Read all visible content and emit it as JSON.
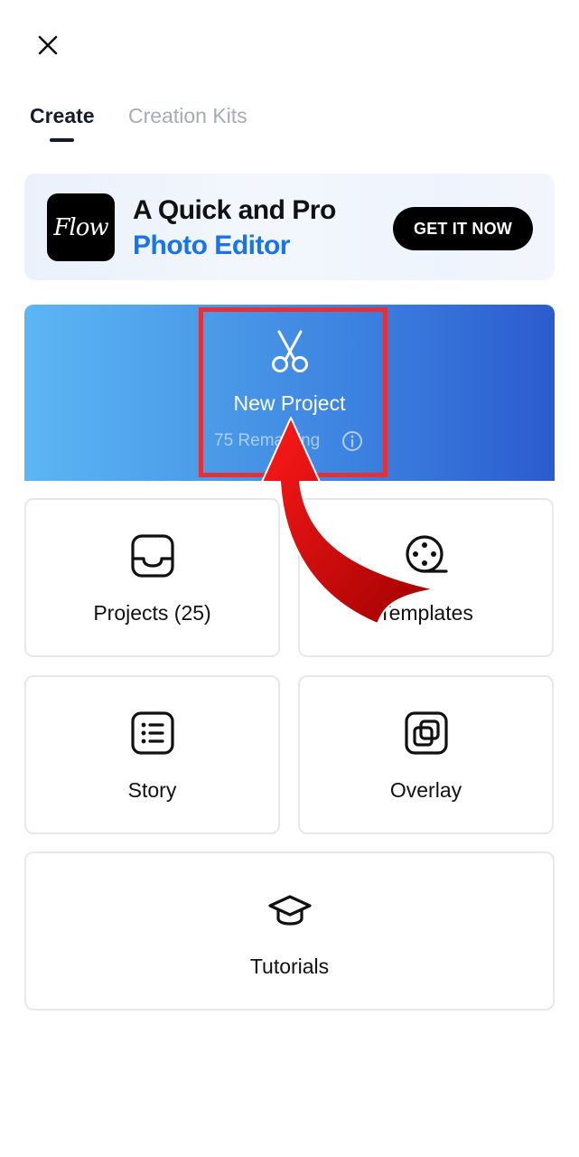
{
  "header": {
    "close_icon": "close-icon"
  },
  "tabs": [
    {
      "label": "Create",
      "active": true
    },
    {
      "label": "Creation Kits",
      "active": false
    }
  ],
  "banner": {
    "logo_text": "Flow",
    "title_line1": "A Quick and Pro",
    "title_line2": "Photo Editor",
    "cta": "GET IT NOW",
    "accent_color": "#1a73e8"
  },
  "new_project": {
    "label": "New Project",
    "remaining": "75 Remaining",
    "icon": "scissors-icon",
    "info_icon": "info-icon"
  },
  "grid": [
    {
      "label": "Projects (25)",
      "icon": "inbox-tray-icon"
    },
    {
      "label": "Templates",
      "icon": "film-reel-icon"
    },
    {
      "label": "Story",
      "icon": "list-icon"
    },
    {
      "label": "Overlay",
      "icon": "layers-icon"
    },
    {
      "label": "Tutorials",
      "icon": "graduation-cap-icon"
    }
  ],
  "annotation": {
    "highlight_color": "#e1323a",
    "arrow_color": "#b30000"
  }
}
